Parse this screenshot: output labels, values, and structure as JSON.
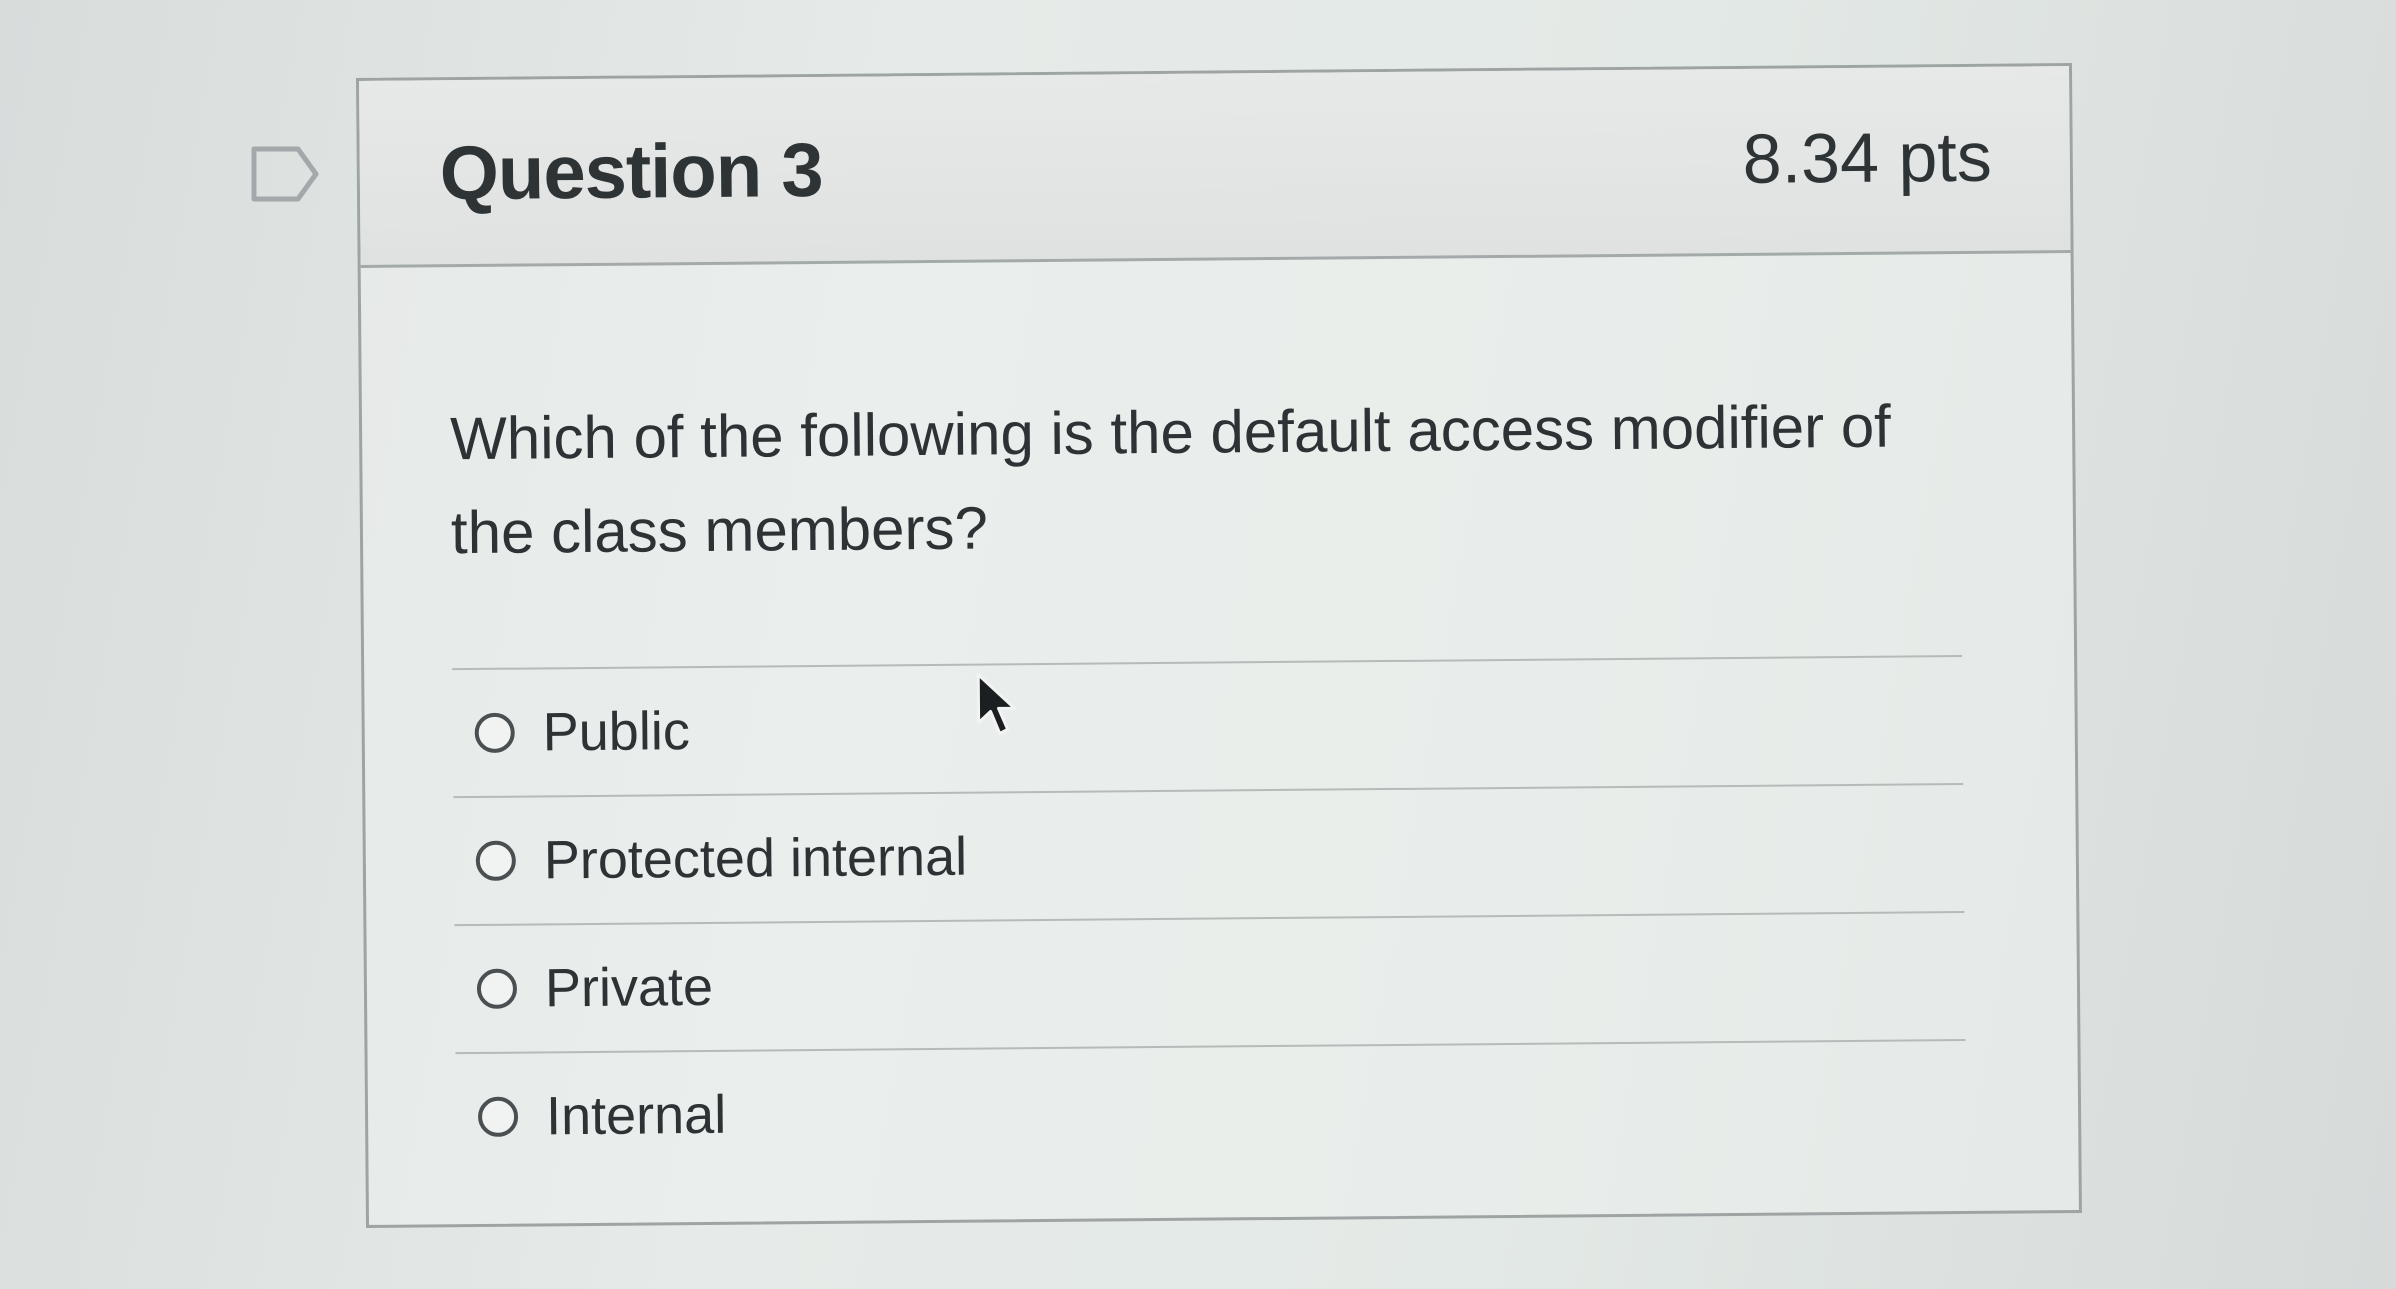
{
  "question": {
    "title": "Question 3",
    "points": "8.34 pts",
    "text": "Which of the following is the default access modifier of the class members?",
    "answers": [
      {
        "label": "Public"
      },
      {
        "label": "Protected internal"
      },
      {
        "label": "Private"
      },
      {
        "label": "Internal"
      }
    ]
  },
  "icons": {
    "flag": "flag-outline-icon",
    "cursor": "mouse-pointer-icon"
  },
  "colors": {
    "text": "#2d3235",
    "border": "#9ea3a4",
    "header_bg": "#e3e6e5"
  }
}
